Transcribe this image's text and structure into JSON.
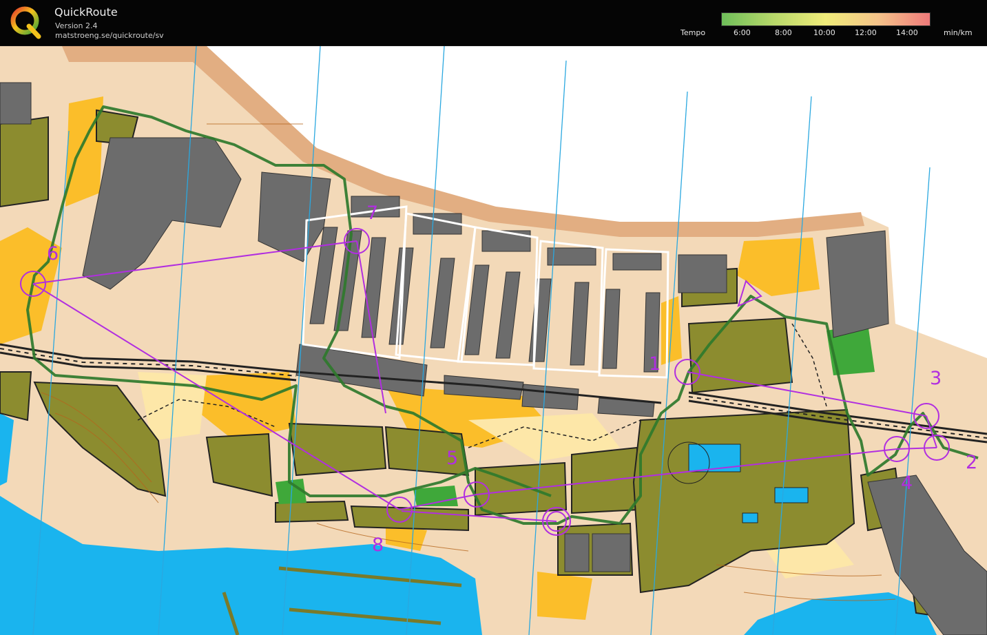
{
  "header": {
    "app_name": "QuickRoute",
    "version": "Version 2.4",
    "url": "matstroeng.se/quickroute/sv",
    "logo_letter": "Q"
  },
  "legend": {
    "title": "Tempo",
    "ticks": [
      "6:00",
      "8:00",
      "10:00",
      "12:00",
      "14:00"
    ],
    "unit": "min/km",
    "colors": [
      "#6fbf5a",
      "#b8d86a",
      "#f0ec7a",
      "#f5c48a",
      "#ee7a7a"
    ]
  },
  "map": {
    "controls": [
      "1",
      "2",
      "3",
      "4",
      "5",
      "6",
      "7",
      "8"
    ],
    "course_color": "#b12ee0",
    "route_color": "#2f7a2c",
    "colors": {
      "paved": "#f3d9b8",
      "road": "#e2ae82",
      "open": "#fbbe2a",
      "forest_green": "#8c8c2f",
      "building": "#6c6c6c",
      "water": "#1ab4ee",
      "meridian": "#2aa8e0"
    }
  }
}
